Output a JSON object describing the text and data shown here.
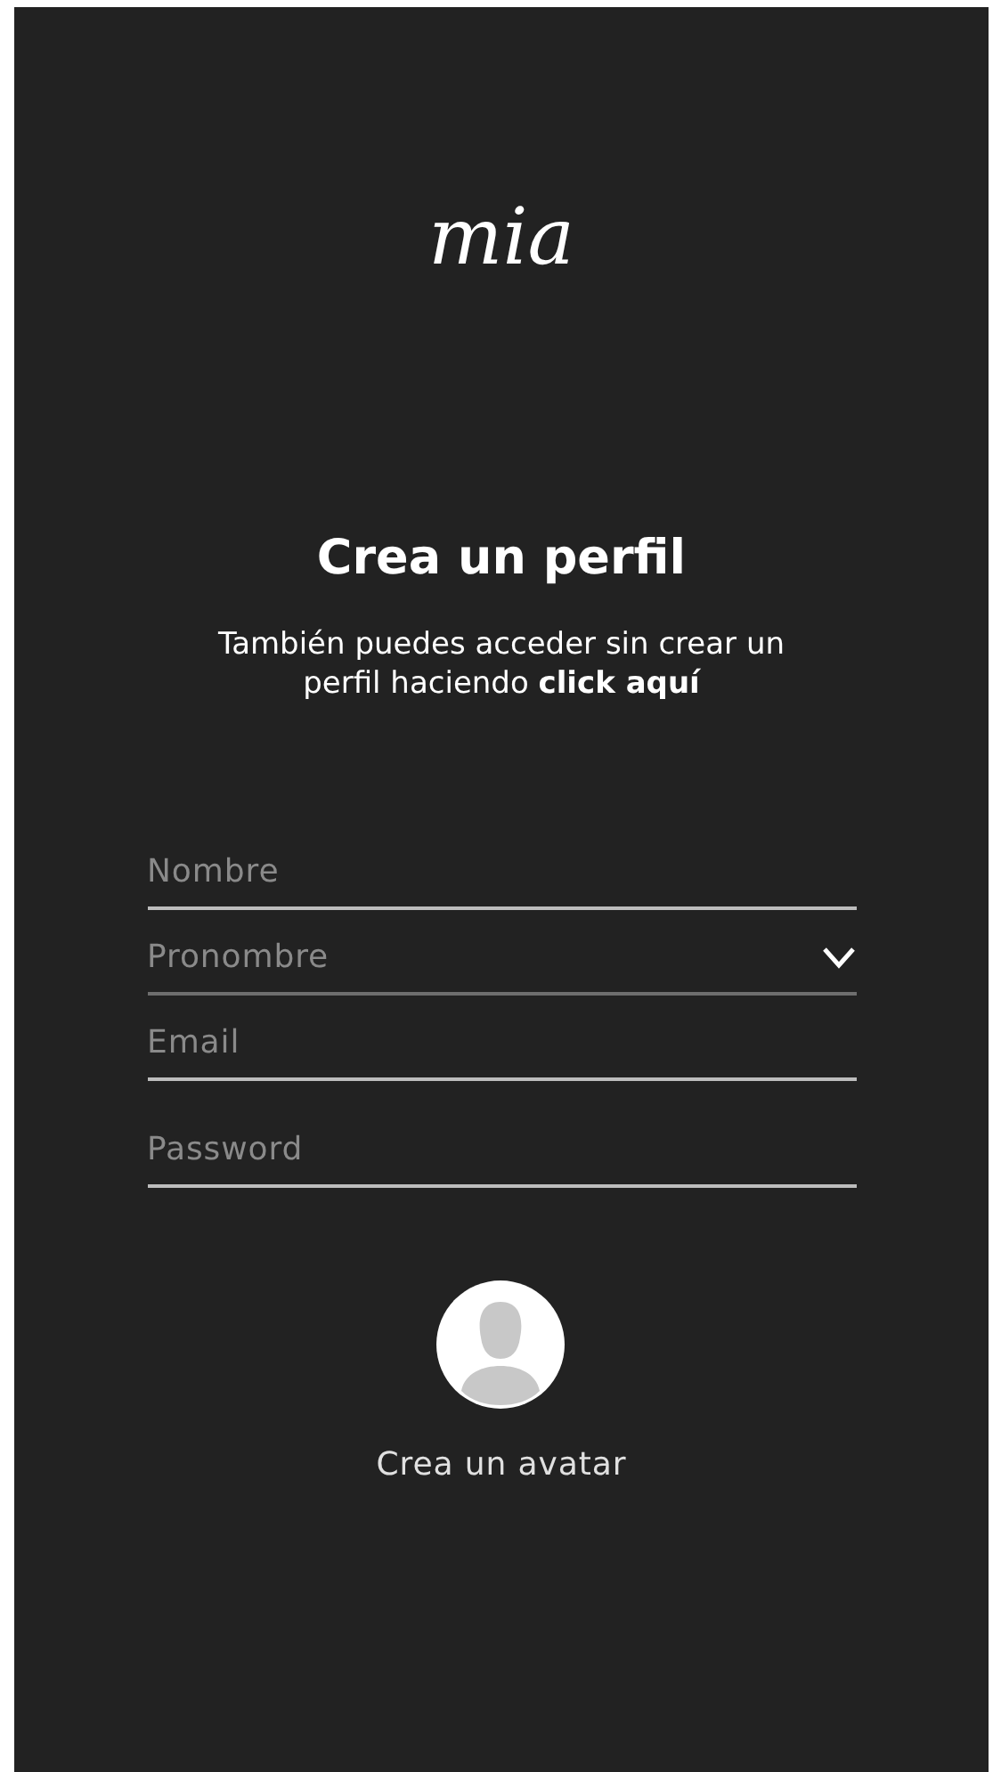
{
  "logo": "mia",
  "title": "Crea un perfil",
  "subtitle": "También puedes acceder sin crear un perfil haciendo **click aquí**",
  "fields": [
    {
      "kind": "text",
      "placeholder": "Nombre"
    },
    {
      "kind": "select",
      "placeholder": "Pronombre"
    },
    {
      "kind": "text",
      "placeholder": "Email"
    },
    {
      "kind": "password",
      "placeholder": "Password"
    }
  ],
  "avatar": {
    "label": "Crea un avatar"
  }
}
